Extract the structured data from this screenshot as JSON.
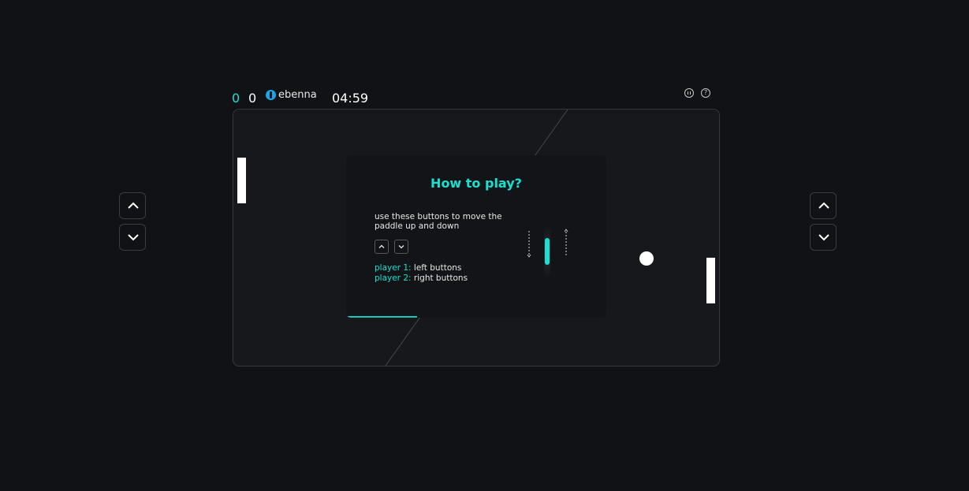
{
  "header": {
    "score_player1": "0",
    "score_player2": "0",
    "brand": "ebenna",
    "timer": "04:59",
    "pause_icon": "pause-icon",
    "help_icon": "help-icon"
  },
  "modal": {
    "title": "How to play?",
    "description": "use these buttons to move the paddle up and down",
    "player1_key": "player 1:",
    "player1_value": "left buttons",
    "player2_key": "player 2:",
    "player2_value": "right buttons",
    "progress": 0.27
  },
  "controls": {
    "left": [
      "chevron-up-icon",
      "chevron-down-icon"
    ],
    "right": [
      "chevron-up-icon",
      "chevron-down-icon"
    ]
  },
  "colors": {
    "accent": "#19e0d0",
    "background": "#111216",
    "board": "#17181c",
    "paddle": "#ffffff"
  }
}
